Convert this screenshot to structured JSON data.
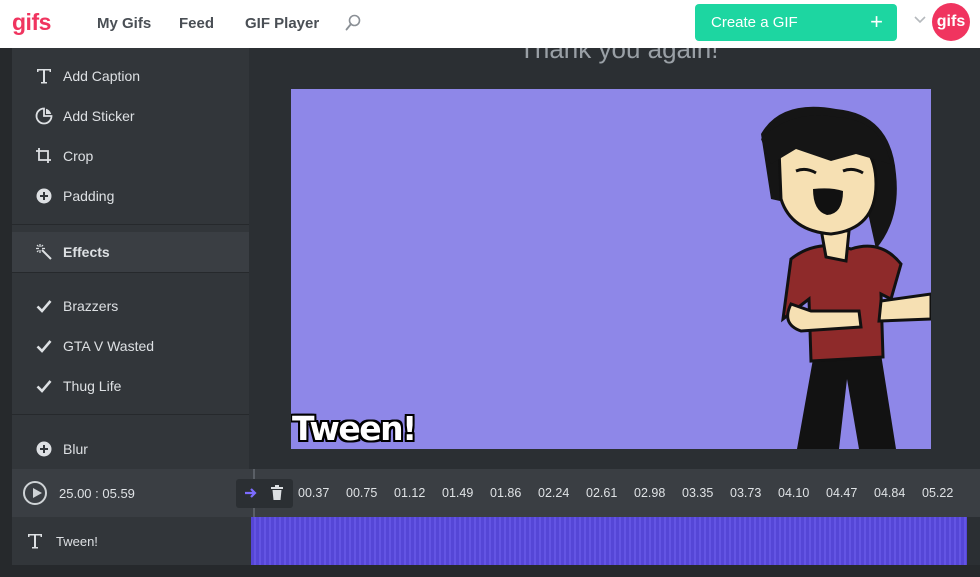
{
  "nav": {
    "logo": "gifs",
    "links": [
      "My Gifs",
      "Feed",
      "GIF Player"
    ],
    "create_label": "Create a GIF",
    "create_plus": "+",
    "avatar_text": "gifs",
    "accent": "#1dd6a1",
    "brand": "#f0345f"
  },
  "sidebar": {
    "tools": [
      {
        "label": "Add Caption",
        "icon": "text-icon"
      },
      {
        "label": "Add Sticker",
        "icon": "sticker-icon"
      },
      {
        "label": "Crop",
        "icon": "crop-icon"
      },
      {
        "label": "Padding",
        "icon": "plus-circle-icon"
      }
    ],
    "effects_label": "Effects",
    "effects": [
      {
        "label": "Brazzers",
        "icon": "check-icon"
      },
      {
        "label": "GTA V Wasted",
        "icon": "check-icon"
      },
      {
        "label": "Thug Life",
        "icon": "check-icon"
      }
    ],
    "blur_label": "Blur"
  },
  "stage": {
    "ghost_caption": "Thank you again!",
    "caption_overlay": "Tween!",
    "frame_color": "#8e87e8"
  },
  "timeline": {
    "timecode": "25.00  :  05.59",
    "ticks": [
      "00.37",
      "00.75",
      "01.12",
      "01.49",
      "01.86",
      "02.24",
      "02.61",
      "02.98",
      "03.35",
      "03.73",
      "04.10",
      "04.47",
      "04.84",
      "05.22"
    ],
    "track_label": "Tween!",
    "track_color": "#5546d6"
  }
}
